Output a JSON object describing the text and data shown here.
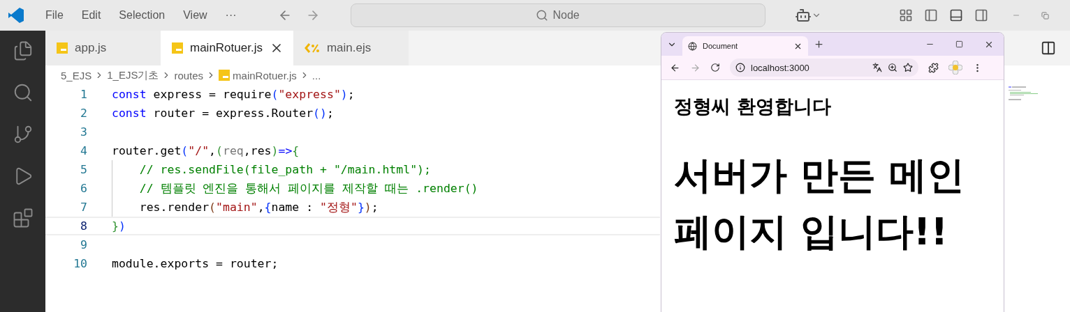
{
  "menu": [
    "File",
    "Edit",
    "Selection",
    "View",
    "···"
  ],
  "command_center": {
    "placeholder": "Node"
  },
  "tabs": [
    {
      "label": "app.js",
      "kind": "js",
      "selected": false
    },
    {
      "label": "mainRotuer.js",
      "kind": "js",
      "selected": true
    },
    {
      "label": "main.ejs",
      "kind": "ejs",
      "selected": false
    }
  ],
  "breadcrumb": [
    {
      "label": "5_EJS",
      "kind": "folder"
    },
    {
      "label": "1_EJS기초",
      "kind": "folder"
    },
    {
      "label": "routes",
      "kind": "folder"
    },
    {
      "label": "mainRotuer.js",
      "kind": "js"
    },
    {
      "label": "...",
      "kind": "folder"
    }
  ],
  "editor": {
    "lines": [
      {
        "number": "1",
        "current": false,
        "tokens": [
          {
            "kind": "keyword",
            "text": "const"
          },
          {
            "kind": "plain",
            "text": " express = require"
          },
          {
            "kind": "brace2",
            "text": "("
          },
          {
            "kind": "string",
            "text": "\"express\""
          },
          {
            "kind": "brace2",
            "text": ")"
          },
          {
            "kind": "plain",
            "text": ";"
          }
        ]
      },
      {
        "number": "2",
        "current": false,
        "tokens": [
          {
            "kind": "keyword",
            "text": "const"
          },
          {
            "kind": "plain",
            "text": " router = express.Router"
          },
          {
            "kind": "brace2",
            "text": "()"
          },
          {
            "kind": "plain",
            "text": ";"
          }
        ]
      },
      {
        "number": "3",
        "current": false
      },
      {
        "number": "4",
        "current": false,
        "tokens": [
          {
            "kind": "plain",
            "text": "router.get"
          },
          {
            "kind": "brace2",
            "text": "("
          },
          {
            "kind": "string",
            "text": "\"/\""
          },
          {
            "kind": "plain",
            "text": ","
          },
          {
            "kind": "brace1",
            "text": "("
          },
          {
            "kind": "faded",
            "text": "req"
          },
          {
            "kind": "plain",
            "text": ",res"
          },
          {
            "kind": "brace1",
            "text": ")"
          },
          {
            "kind": "keyword",
            "text": "=>"
          },
          {
            "kind": "brace1",
            "text": "{"
          }
        ]
      },
      {
        "number": "5",
        "current": false,
        "guide": true,
        "tokens": [
          {
            "kind": "comment",
            "text": "   // res.sendFile(file_path + \"/main.html\");"
          }
        ]
      },
      {
        "number": "6",
        "current": false,
        "guide": true,
        "tokens": [
          {
            "kind": "comment",
            "text": "   // 템플릿 엔진을 통해서 페이지를 제작할 때는 .render()"
          }
        ]
      },
      {
        "number": "7",
        "current": false,
        "guide": true,
        "tokens": [
          {
            "kind": "plain",
            "text": "   res.render"
          },
          {
            "kind": "brace3",
            "text": "("
          },
          {
            "kind": "string",
            "text": "\"main\""
          },
          {
            "kind": "plain",
            "text": ","
          },
          {
            "kind": "brace2",
            "text": "{"
          },
          {
            "kind": "plain",
            "text": "name : "
          },
          {
            "kind": "string",
            "text": "\"정형\""
          },
          {
            "kind": "brace2",
            "text": "}"
          },
          {
            "kind": "brace3",
            "text": ")"
          },
          {
            "kind": "plain",
            "text": ";"
          }
        ]
      },
      {
        "number": "8",
        "current": true,
        "tokens": [
          {
            "kind": "brace1",
            "text": "}"
          },
          {
            "kind": "brace2",
            "text": ")"
          }
        ]
      },
      {
        "number": "9",
        "current": false
      },
      {
        "number": "10",
        "current": false,
        "tokens": [
          {
            "kind": "plain",
            "text": "module.exports = router;"
          }
        ]
      }
    ]
  },
  "browser": {
    "tab": {
      "title": "Document",
      "selected": true
    },
    "url": "localhost:3000",
    "page": {
      "heading": "정형씨 환영합니다",
      "title": "서버가 만든 메인 페이지 입니다!!"
    }
  }
}
